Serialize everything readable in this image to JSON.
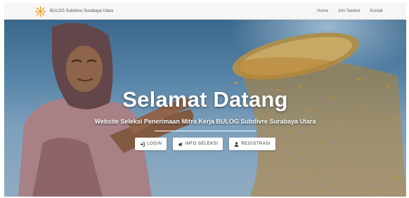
{
  "navbar": {
    "brand": "BULOG Subdivre Surabaya Utara",
    "logo_icon": "sun-logo-icon",
    "links": [
      "Home",
      "Info Seleksi",
      "Kontak"
    ]
  },
  "hero": {
    "title": "Selamat Datang",
    "subtitle": "Website Seleksi Penerimaan Mitra Kerja BULOG Subdivre Surabaya Utara",
    "buttons": [
      {
        "label": "LOGIN",
        "icon": "sign-in-icon"
      },
      {
        "label": "INFO SELEKSI",
        "icon": "bullhorn-icon"
      },
      {
        "label": "REGISTRASI",
        "icon": "user-icon"
      }
    ]
  },
  "colors": {
    "logo_orange": "#f39c12",
    "text_dark": "#333333",
    "sky_blue": "#5f8fb4"
  }
}
